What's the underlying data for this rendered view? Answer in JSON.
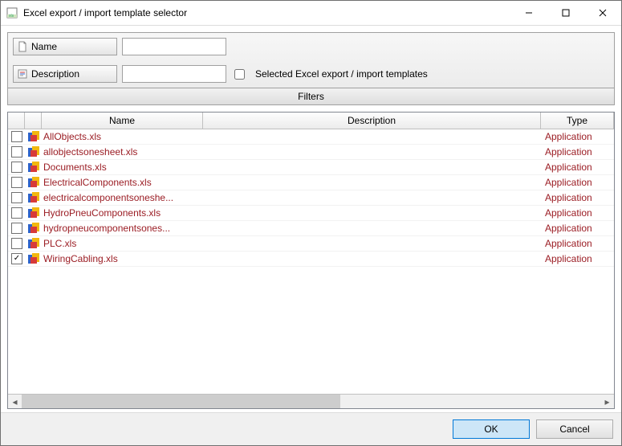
{
  "window": {
    "title": "Excel export / import template selector"
  },
  "filters": {
    "name_label": "Name",
    "description_label": "Description",
    "name_value": "",
    "description_value": "",
    "selected_checkbox_label": "Selected Excel export / import templates",
    "selected_checked": false,
    "header": "Filters"
  },
  "table": {
    "columns": {
      "name": "Name",
      "description": "Description",
      "type": "Type"
    },
    "rows": [
      {
        "checked": false,
        "name": "AllObjects.xls",
        "description": "",
        "type": "Application"
      },
      {
        "checked": false,
        "name": "allobjectsonesheet.xls",
        "description": "",
        "type": "Application"
      },
      {
        "checked": false,
        "name": "Documents.xls",
        "description": "",
        "type": "Application"
      },
      {
        "checked": false,
        "name": "ElectricalComponents.xls",
        "description": "",
        "type": "Application"
      },
      {
        "checked": false,
        "name": "electricalcomponentsoneshe...",
        "description": "",
        "type": "Application"
      },
      {
        "checked": false,
        "name": "HydroPneuComponents.xls",
        "description": "",
        "type": "Application"
      },
      {
        "checked": false,
        "name": "hydropneucomponentsones...",
        "description": "",
        "type": "Application"
      },
      {
        "checked": false,
        "name": "PLC.xls",
        "description": "",
        "type": "Application"
      },
      {
        "checked": true,
        "name": "WiringCabling.xls",
        "description": "",
        "type": "Application"
      }
    ]
  },
  "buttons": {
    "ok": "OK",
    "cancel": "Cancel"
  }
}
